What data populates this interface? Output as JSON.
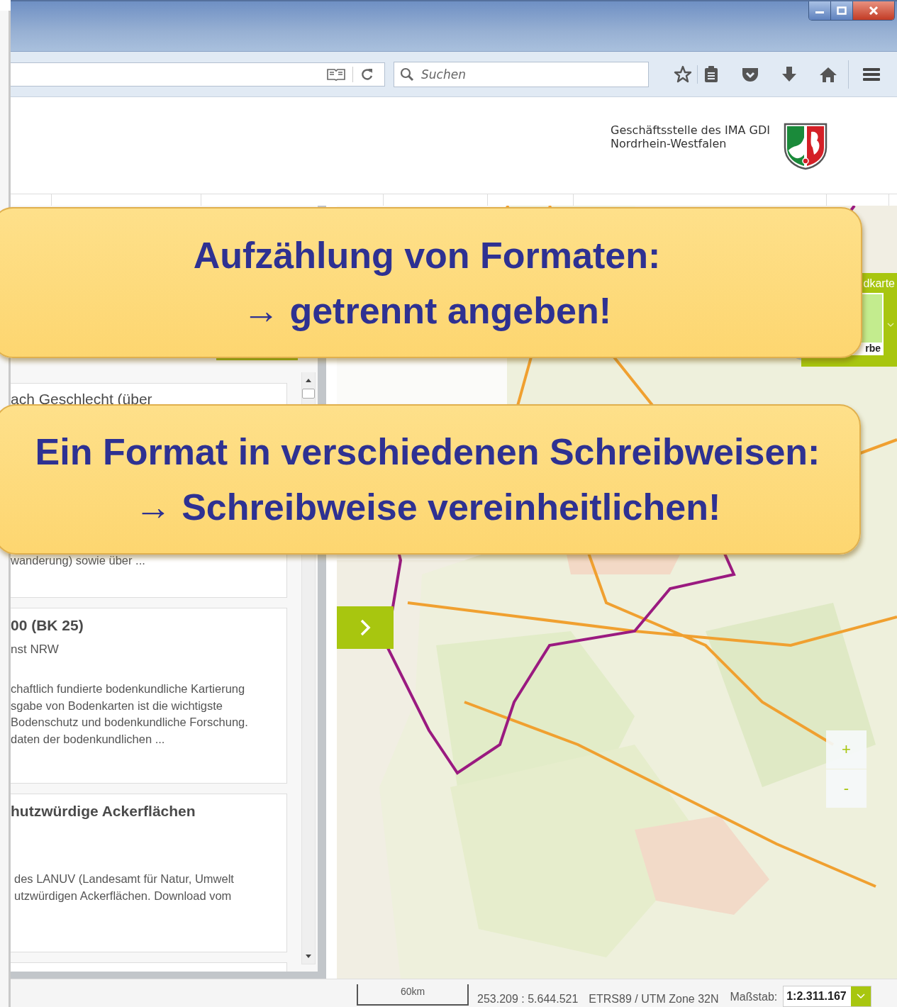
{
  "toolbar": {
    "search": {
      "placeholder": "Suchen"
    }
  },
  "header": {
    "org_lines": [
      "Geschäftsstelle des IMA GDI",
      "Nordrhein-Westfalen"
    ]
  },
  "sidebar": {
    "cards": [
      {
        "title": "ach Geschlecht (über",
        "description": [
          "wanderung) sowie über ..."
        ]
      },
      {
        "title": "00 (BK 25)",
        "subtitle": "nst NRW",
        "description": [
          "chaftlich fundierte bodenkundliche Kartierung",
          "sgabe von Bodenkarten ist die wichtigste",
          "Bodenschutz und bodenkundliche Forschung.",
          "daten der bodenkundlichen ..."
        ]
      },
      {
        "title": "hutzwürdige Ackerflächen",
        "description": [
          "des LANUV (Landesamt für Natur, Umwelt",
          "utzwürdigen Ackerflächen. Download vom"
        ]
      }
    ]
  },
  "map": {
    "basemap_switch": {
      "label": "dkarte",
      "option": "rbe"
    },
    "zoom": [
      "+",
      "-"
    ]
  },
  "status_bar": {
    "scale_label": "60km",
    "coordinates": "253.209 : 5.644.521",
    "crs": "ETRS89 / UTM Zone 32N",
    "scale_caption": "Maßstab:",
    "scale_value": "1:2.311.167"
  },
  "callouts": [
    {
      "lines": [
        "Aufzählung von Formaten:",
        "→ getrennt angeben!"
      ]
    },
    {
      "lines": [
        "Ein Format in verschiedenen Schreibweisen:",
        "→ Schreibweise vereinheitlichen!"
      ]
    }
  ]
}
